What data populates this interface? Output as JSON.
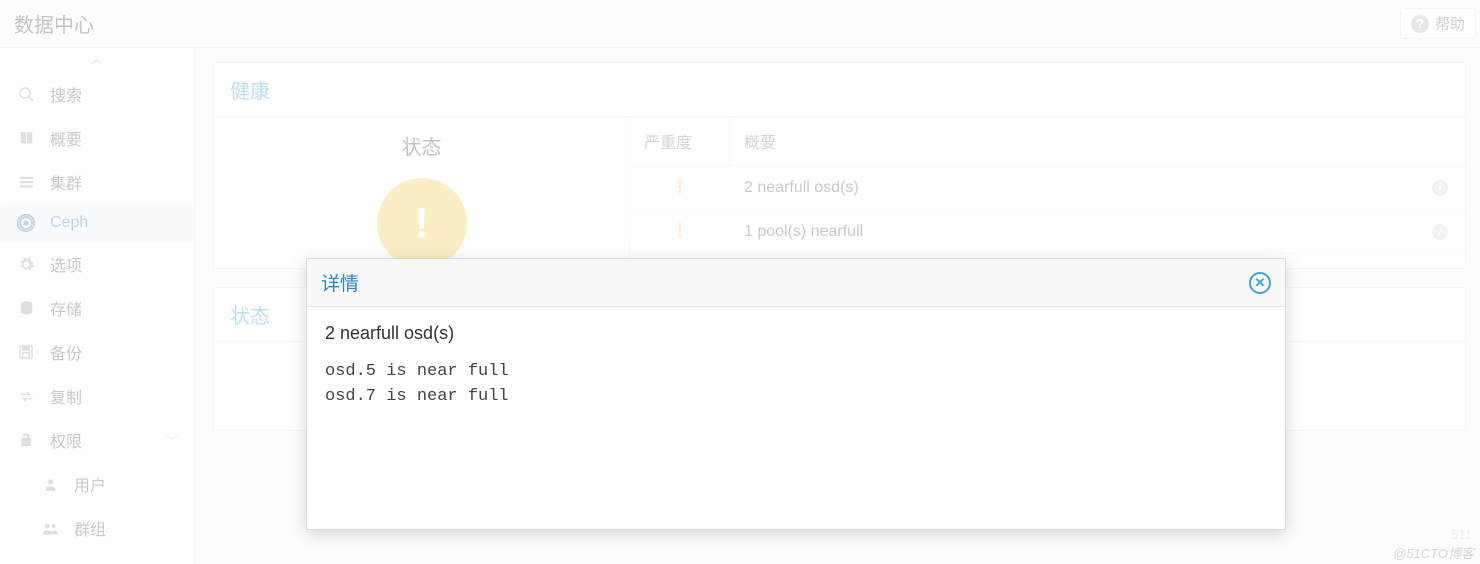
{
  "titlebar": {
    "title": "数据中心",
    "help_label": "帮助"
  },
  "sidebar": {
    "items": [
      {
        "icon": "search",
        "label": "搜索"
      },
      {
        "icon": "book",
        "label": "概要"
      },
      {
        "icon": "list",
        "label": "集群"
      },
      {
        "icon": "wifi",
        "label": "Ceph",
        "active": true
      },
      {
        "icon": "gear",
        "label": "选项"
      },
      {
        "icon": "db",
        "label": "存储"
      },
      {
        "icon": "save",
        "label": "备份"
      },
      {
        "icon": "retweet",
        "label": "复制"
      },
      {
        "icon": "lock",
        "label": "权限",
        "expandable": true
      },
      {
        "icon": "user",
        "label": "用户",
        "sub": true
      },
      {
        "icon": "users",
        "label": "群组",
        "sub": true
      }
    ]
  },
  "health": {
    "panel_title": "健康",
    "status_label": "状态",
    "columns": {
      "severity": "严重度",
      "summary": "概要"
    },
    "rows": [
      {
        "severity": "warn",
        "summary": "2 nearfull osd(s)"
      },
      {
        "severity": "warn",
        "summary": "1 pool(s) nearfull"
      }
    ]
  },
  "status_panel": {
    "title": "状态"
  },
  "modal": {
    "title": "详情",
    "heading": "2 nearfull osd(s)",
    "body": "osd.5 is near full\nosd.7 is near full"
  },
  "page_number": "511",
  "watermark": "@51CTO博客"
}
